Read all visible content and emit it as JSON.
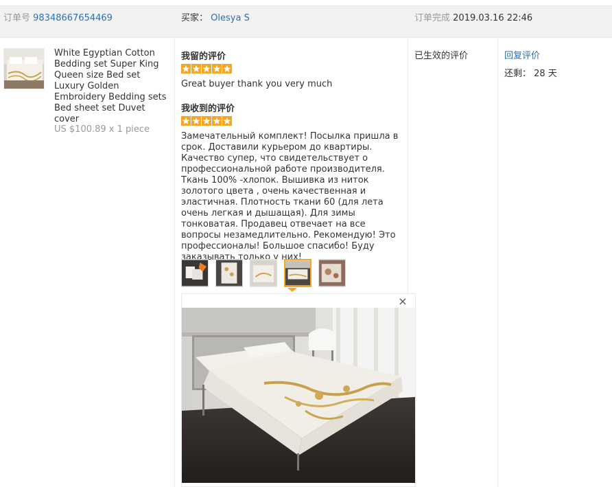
{
  "header": {
    "order_label": "订单号",
    "order_number": "98348667654469",
    "buyer_label": "买家：",
    "buyer_name": "Olesya S",
    "completed_label": "订单完成",
    "completed_time": "2019.03.16 22:46"
  },
  "product": {
    "title": "White Egyptian Cotton Bedding set Super King Queen size Bed set Luxury Golden Embroidery Bedding sets Bed sheet set Duvet cover",
    "price": "US $100.89 x 1 piece"
  },
  "my_review": {
    "title": "我留的评价",
    "stars": 5,
    "text": "Great buyer thank you very much"
  },
  "received_review": {
    "title": "我收到的评价",
    "stars": 5,
    "text": "Замечательный комплект! Посылка пришла в срок. Доставили курьером до квартиры. Качество супер, что свидетельствует о профессиональной работе производителя. Ткань 100% -хлопок. Вышивка из ниток золотого цвета , очень качественная и эластичная. Плотность ткани 60 (для лета очень легкая и дышащая). Для зимы тонковатая. Продавец отвечает на все вопросы незамедлительно. Рекомендую! Это профессионалы! Большое спасибо! Буду заказывать только у них!",
    "photos_count": 5,
    "active_photo_index": 3
  },
  "preview": {
    "close_glyph": "×"
  },
  "status": {
    "text": "已生效的评价"
  },
  "actions": {
    "reply_label": "回复评价",
    "remaining_label": "还剩：",
    "remaining_value": "28 天"
  },
  "colors": {
    "link": "#2c6fb0",
    "star": "#f5a623",
    "header_bg": "#f2f2f2"
  }
}
